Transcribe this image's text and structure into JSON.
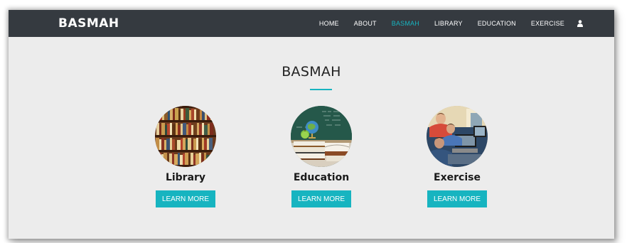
{
  "header": {
    "brand": "BASMAH",
    "nav": [
      {
        "label": "HOME",
        "active": false
      },
      {
        "label": "ABOUT",
        "active": false
      },
      {
        "label": "BASMAH",
        "active": true
      },
      {
        "label": "LIBRARY",
        "active": false
      },
      {
        "label": "EDUCATION",
        "active": false
      },
      {
        "label": "EXERCISE",
        "active": false
      }
    ],
    "user_icon": "user-icon"
  },
  "main": {
    "title": "BASMAH",
    "cards": [
      {
        "title": "Library",
        "button": "LEARN MORE",
        "image": "bookshelf-image"
      },
      {
        "title": "Education",
        "button": "LEARN MORE",
        "image": "books-globe-chalkboard-image"
      },
      {
        "title": "Exercise",
        "button": "LEARN MORE",
        "image": "students-computers-image"
      }
    ]
  },
  "colors": {
    "navbar": "#353a40",
    "accent": "#17b4c0",
    "background": "#ececec"
  }
}
